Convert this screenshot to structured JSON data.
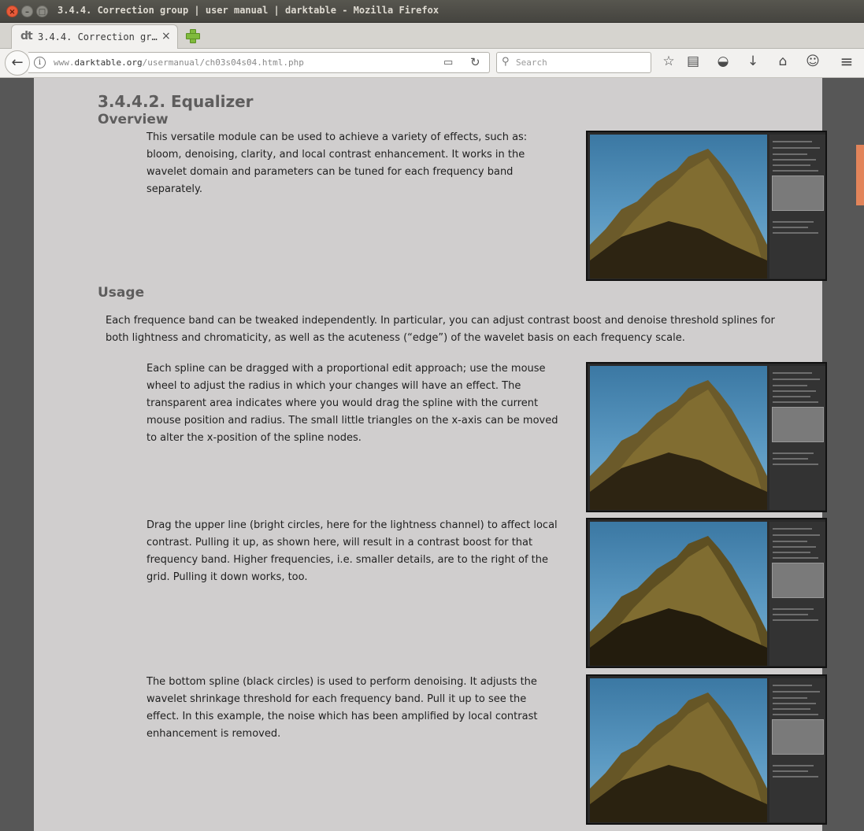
{
  "window": {
    "title": "3.4.4. Correction group | user manual | darktable - Mozilla Firefox",
    "close_glyph": "×",
    "min_glyph": "–",
    "max_glyph": "□"
  },
  "tab": {
    "favicon_text": "dt",
    "title": "3.4.4. Correction gr…",
    "close_glyph": "×"
  },
  "navbar": {
    "url_prefix": "www.",
    "url_domain": "darktable.org",
    "url_path": "/usermanual/ch03s04s04.html.php",
    "search_placeholder": "Search",
    "icons": {
      "back": "←",
      "info": "i",
      "reader": "▭",
      "reload": "↻",
      "search": "⚲",
      "bookmark": "☆",
      "library": "▤",
      "pocket": "◒",
      "download": "↓",
      "home": "⌂",
      "hello": "☺",
      "menu": "≡"
    }
  },
  "doc": {
    "section_title": "3.4.4.2. Equalizer",
    "overview_heading": "Overview",
    "overview_text": "This versatile module can be used to achieve a variety of effects, such as: bloom, denoising, clarity, and local contrast enhancement. It works in the wavelet domain and parameters can be tuned for each frequency band separately.",
    "usage_heading": "Usage",
    "usage_intro": "Each frequence band can be tweaked independently. In particular, you can adjust contrast boost and denoise threshold splines for both lightness and chromaticity, as well as the acuteness (“edge”) of the wavelet basis on each frequency scale.",
    "para_spline": "Each spline can be dragged with a proportional edit approach; use the mouse wheel to adjust the radius in which your changes will have an effect. The transparent area indicates where you would drag the spline with the current mouse position and radius. The small little triangles on the x-axis can be moved to alter the x-position of the spline nodes.",
    "para_upper": "Drag the upper line (bright circles, here for the lightness channel) to affect local contrast. Pulling it up, as shown here, will result in a contrast boost for that frequency band. Higher frequencies, i.e. smaller details, are to the right of the grid. Pulling it down works, too.",
    "para_bottom": "The bottom spline (black circles) is used to perform denoising. It adjusts the wavelet shrinkage threshold for each frequency band. Pull it up to see the effect. In this example, the noise which has been amplified by local contrast enhancement is removed."
  },
  "colors": {
    "page_bg": "#d0cece",
    "side_bg": "#575757",
    "heading": "#5e5d5d",
    "scroll_thumb": "#e2845a"
  }
}
